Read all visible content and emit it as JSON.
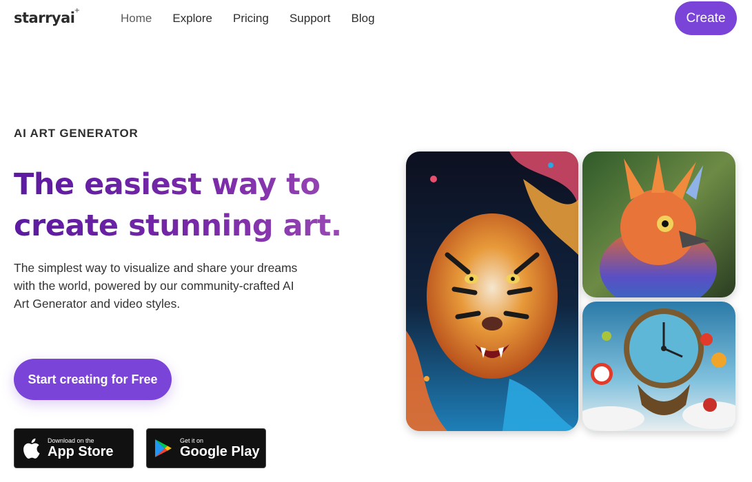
{
  "header": {
    "logo": "starryai",
    "logo_spark": "+",
    "nav": [
      "Home",
      "Explore",
      "Pricing",
      "Support",
      "Blog"
    ],
    "create_label": "Create"
  },
  "hero": {
    "eyebrow": "AI ART GENERATOR",
    "headline_line1": "The easiest way to",
    "headline_line2": "create stunning art.",
    "subtitle_line1": "The simplest way to visualize and share your dreams",
    "subtitle_line2": "with the world, powered by our community-crafted AI",
    "subtitle_line3": "Art Generator and video styles.",
    "cta_label": "Start creating for Free"
  },
  "stores": {
    "apple_small": "Download on the",
    "apple_big": "App Store",
    "google_small": "Get it on",
    "google_big": "Google Play"
  },
  "gallery": [
    {
      "name": "tiger-artwork",
      "icon": "tiger-image"
    },
    {
      "name": "bird-artwork",
      "icon": "bird-image"
    },
    {
      "name": "clock-artwork",
      "icon": "clock-image"
    }
  ],
  "colors": {
    "accent": "#7a44d9",
    "headline_gradient_start": "#5b1aa0",
    "headline_gradient_end": "#a04fb8",
    "store_badge": "#111111"
  }
}
